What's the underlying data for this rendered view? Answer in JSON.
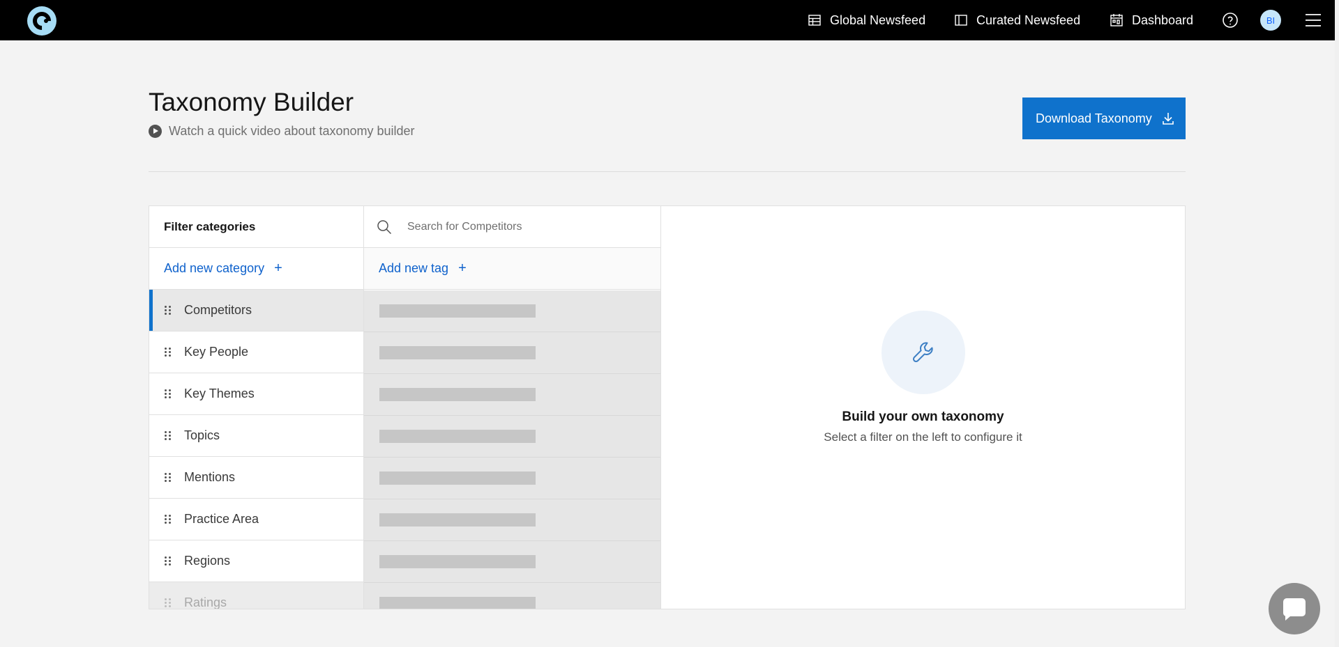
{
  "topnav": {
    "items": [
      {
        "label": "Global Newsfeed",
        "icon": "table-icon"
      },
      {
        "label": "Curated Newsfeed",
        "icon": "panel-icon"
      },
      {
        "label": "Dashboard",
        "icon": "calendar-grid-icon"
      }
    ],
    "avatar_initials": "BI"
  },
  "header": {
    "title": "Taxonomy Builder",
    "video_link": "Watch a quick video about taxonomy builder",
    "download_label": "Download Taxonomy"
  },
  "categories": {
    "heading": "Filter categories",
    "add_label": "Add new category",
    "add_symbol": "+",
    "items": [
      {
        "label": "Competitors"
      },
      {
        "label": "Key People"
      },
      {
        "label": "Key Themes"
      },
      {
        "label": "Topics"
      },
      {
        "label": "Mentions"
      },
      {
        "label": "Practice Area"
      },
      {
        "label": "Regions"
      },
      {
        "label": "Ratings"
      }
    ],
    "active_index": 0
  },
  "tags": {
    "search_placeholder": "Search for Competitors",
    "add_label": "Add new tag",
    "add_symbol": "+"
  },
  "detail": {
    "title": "Build your own taxonomy",
    "subtitle": "Select a filter on the left to configure it"
  },
  "colors": {
    "accent": "#0f72cc",
    "topbar": "#000000",
    "background": "#f3f3f3"
  }
}
